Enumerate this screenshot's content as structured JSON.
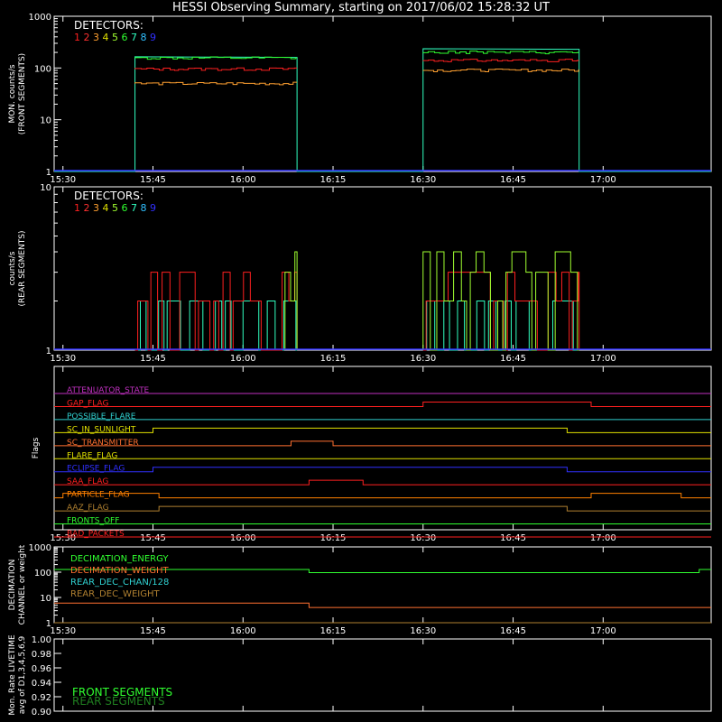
{
  "title": "HESSI Observing Summary, starting on 2017/06/02 15:28:32 UT",
  "time_ticks": [
    "15:30",
    "15:45",
    "16:00",
    "16:15",
    "16:30",
    "16:45",
    "17:00"
  ],
  "time_axis": {
    "start": "15:28:32",
    "end": "17:18",
    "tick_minutes": [
      30,
      45,
      60,
      75,
      90,
      105,
      120
    ]
  },
  "detector_colors": [
    "#ff2020",
    "#ff3030",
    "#ffa030",
    "#e0e000",
    "#a0ff30",
    "#30ff30",
    "#30ffc0",
    "#30c0ff",
    "#3030ff"
  ],
  "chart_data": [
    {
      "type": "line",
      "title": "",
      "ylabel_line1": "MON. counts/s",
      "ylabel_line2": "(FRONT SEGMENTS)",
      "yscale": "log",
      "ylim": [
        1,
        1000
      ],
      "y_ticks": [
        "1",
        "10",
        "100",
        "1000"
      ],
      "legend_title": "DETECTORS:",
      "legend_entries": [
        "1",
        "2",
        "3",
        "4",
        "5",
        "6",
        "7",
        "8",
        "9"
      ],
      "legend_placement": "top-left",
      "series": [
        {
          "color": "#30ffc0",
          "x": [
            "15:28:32",
            "15:42",
            "15:42",
            "16:09",
            "16:09",
            "16:30",
            "16:30",
            "16:56",
            "16:56",
            "17:18"
          ],
          "y": [
            1,
            1,
            165,
            160,
            1,
            1,
            235,
            230,
            1,
            1
          ]
        },
        {
          "color": "#30ff30",
          "x": [
            "15:42",
            "16:09",
            "16:30",
            "16:56"
          ],
          "y": [
            155,
            155,
            200,
            195
          ]
        },
        {
          "color": "#ff2020",
          "x": [
            "15:42",
            "16:09",
            "16:30",
            "16:56"
          ],
          "y": [
            95,
            100,
            140,
            125
          ]
        },
        {
          "color": "#ffa030",
          "x": [
            "15:42",
            "16:09",
            "16:30",
            "16:56"
          ],
          "y": [
            50,
            65,
            90,
            75
          ]
        },
        {
          "color": "#3030ff",
          "x": [
            "15:28:32",
            "17:18"
          ],
          "y": [
            1,
            1
          ]
        }
      ]
    },
    {
      "type": "line",
      "title": "",
      "ylabel_line1": "counts/s",
      "ylabel_line2": "(REAR SEGMENTS)",
      "yscale": "log",
      "ylim": [
        1,
        10
      ],
      "y_ticks": [
        "1",
        "10"
      ],
      "legend_title": "DETECTORS:",
      "legend_entries": [
        "1",
        "2",
        "3",
        "4",
        "5",
        "6",
        "7",
        "8",
        "9"
      ],
      "legend_placement": "top-left",
      "series": [
        {
          "name": "",
          "color": "#30ffc0",
          "pattern": "toggling between 1 and 2 counts/s",
          "x_ranges": [
            [
              "15:42",
              "16:09"
            ],
            [
              "16:30",
              "16:56"
            ]
          ],
          "y_levels": [
            1,
            2
          ]
        },
        {
          "name": "",
          "color": "#ff2020",
          "pattern": "toggling between 1, 2 and 3 counts/s",
          "x_ranges": [
            [
              "15:42",
              "16:09"
            ],
            [
              "16:30",
              "16:56"
            ]
          ],
          "y_levels": [
            1,
            2,
            3
          ]
        },
        {
          "name": "",
          "color": "#a0ff30",
          "pattern": "toggling between 1, 2, 3 and 4 counts/s",
          "x_ranges": [
            [
              "16:07",
              "16:09"
            ],
            [
              "16:30",
              "16:56"
            ]
          ],
          "y_levels": [
            1,
            2,
            3,
            4
          ]
        }
      ]
    },
    {
      "type": "line",
      "title": "",
      "ylabel_line1": "Flags",
      "flags": [
        {
          "label": "ATTENUATOR_STATE",
          "color": "#c030c0",
          "transitions": []
        },
        {
          "label": "GAP_FLAG",
          "color": "#ff2020",
          "transitions": [
            "16:30",
            "16:58"
          ]
        },
        {
          "label": "POSSIBLE_FLARE",
          "color": "#30d0d0",
          "transitions": []
        },
        {
          "label": "SC_IN_SUNLIGHT",
          "color": "#e0e000",
          "transitions": [
            "15:45",
            "16:54"
          ]
        },
        {
          "label": "SC_TRANSMITTER",
          "color": "#ff7030",
          "transitions": [
            "16:08",
            "16:15"
          ]
        },
        {
          "label": "FLARE_FLAG",
          "color": "#e0e000",
          "transitions": []
        },
        {
          "label": "ECLIPSE_FLAG",
          "color": "#3030ff",
          "transitions": [
            "15:45",
            "16:54"
          ]
        },
        {
          "label": "SAA_FLAG",
          "color": "#ff2020",
          "transitions": [
            "16:11",
            "16:20"
          ]
        },
        {
          "label": "PARTICLE_FLAG",
          "color": "#ff8000",
          "transitions": [
            "15:30",
            "15:46",
            "16:58",
            "17:13"
          ]
        },
        {
          "label": "AAZ_FLAG",
          "color": "#b08030",
          "transitions": [
            "15:46",
            "16:54"
          ]
        },
        {
          "label": "FRONTS_OFF",
          "color": "#30ff30",
          "transitions": []
        },
        {
          "label": "BAD_PACKETS",
          "color": "#ff2020",
          "transitions": []
        }
      ]
    },
    {
      "type": "line",
      "title": "",
      "ylabel_line1": "DECIMATION",
      "ylabel_line2": "CHANNEL or weight",
      "yscale": "log",
      "ylim": [
        1,
        1000
      ],
      "y_ticks": [
        "1",
        "10",
        "100",
        "1000"
      ],
      "legend_placement": "top-left",
      "series": [
        {
          "name": "DECIMATION_ENERGY",
          "color": "#30ff30",
          "x": [
            "15:28:32",
            "16:11",
            "16:11",
            "17:16",
            "17:16",
            "17:18"
          ],
          "y": [
            128,
            128,
            96,
            96,
            128,
            128
          ]
        },
        {
          "name": "DECIMATION_WEIGHT",
          "color": "#ff7030",
          "x": [
            "15:28:32",
            "16:11",
            "16:11",
            "17:18"
          ],
          "y": [
            6,
            6,
            4,
            4
          ]
        },
        {
          "name": "REAR_DEC_CHAN/128",
          "color": "#30d0d0",
          "x": [
            "15:28:32",
            "17:18"
          ],
          "y": [
            1,
            1
          ]
        },
        {
          "name": "REAR_DEC_WEIGHT",
          "color": "#b08030",
          "x": [
            "15:28:32",
            "17:18"
          ],
          "y": [
            1,
            1
          ]
        }
      ]
    },
    {
      "type": "line",
      "title": "",
      "ylabel_line1": "Mon. Rate LIVETIME",
      "ylabel_line2": "avg of D1,3,4,5,6,9",
      "ylim": [
        0.9,
        1.0
      ],
      "y_ticks": [
        "0.90",
        "0.92",
        "0.94",
        "0.96",
        "0.98",
        "1.00"
      ],
      "legend_placement": "bottom-left",
      "series": [
        {
          "name": "FRONT SEGMENTS",
          "color": "#30ff30",
          "x": [],
          "y": []
        },
        {
          "name": "REAR SEGMENTS",
          "color": "#208020",
          "x": [],
          "y": []
        }
      ]
    }
  ]
}
